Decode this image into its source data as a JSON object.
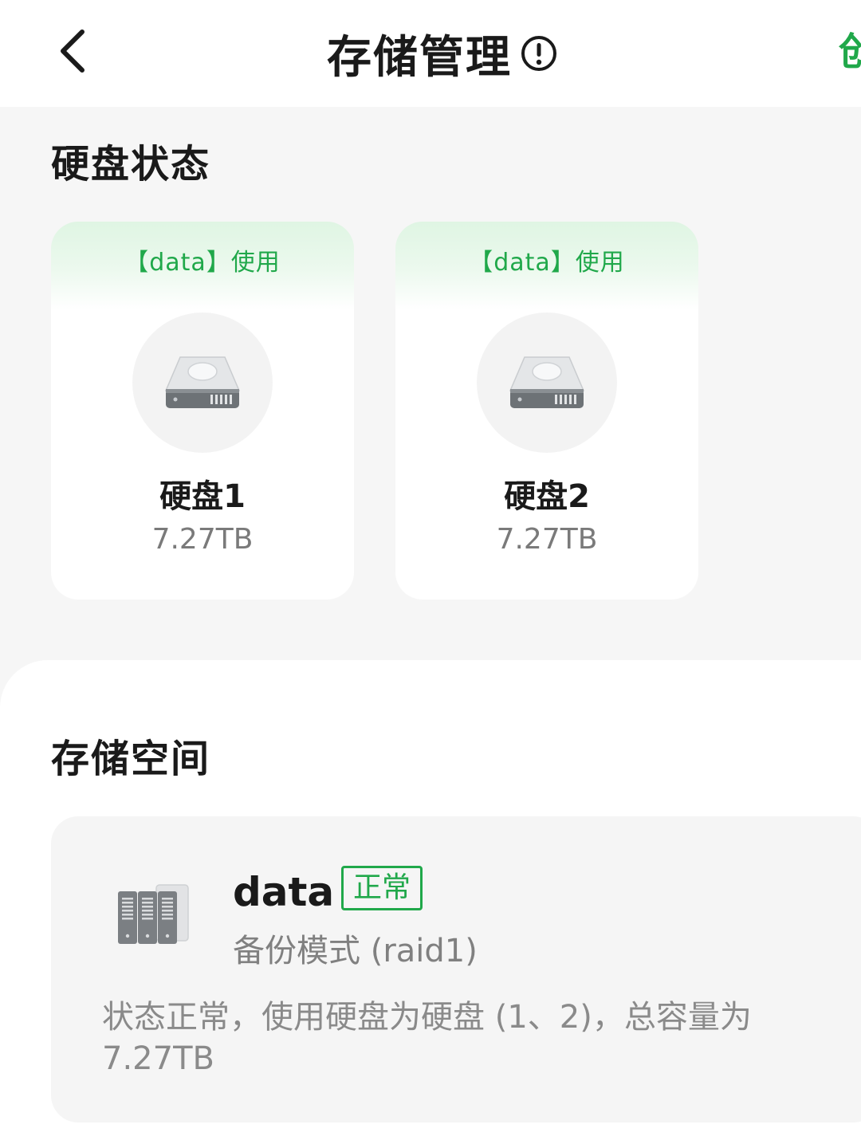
{
  "header": {
    "title": "存储管理",
    "back_icon": "chevron-left-icon",
    "info_icon": "exclamation-circle-icon",
    "right_action_label": "创"
  },
  "disk_status": {
    "title": "硬盘状态",
    "disks": [
      {
        "usage": "【data】使用",
        "name": "硬盘1",
        "size": "7.27TB",
        "icon": "hard-drive-icon"
      },
      {
        "usage": "【data】使用",
        "name": "硬盘2",
        "size": "7.27TB",
        "icon": "hard-drive-icon"
      }
    ]
  },
  "storage_space": {
    "title": "存储空间",
    "volume": {
      "name": "data",
      "status": "正常",
      "mode": "备份模式 (raid1)",
      "description": "状态正常，使用硬盘为硬盘 (1、2)，总容量为7.27TB",
      "icon": "server-rack-icon"
    }
  },
  "colors": {
    "accent": "#20a84a",
    "background": "#f6f6f6",
    "card": "#ffffff",
    "muted_text": "#7a7a7a"
  }
}
